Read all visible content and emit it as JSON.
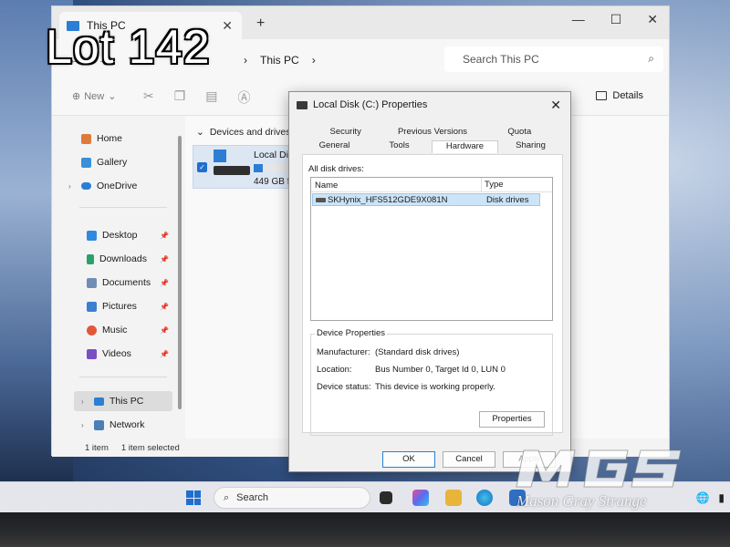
{
  "overlay": {
    "lot_label": "Lot 142",
    "watermark_logo": "MGS",
    "watermark_text": "Mason Gray Strange"
  },
  "explorer": {
    "tab_title": "This PC",
    "breadcrumb": [
      "This PC"
    ],
    "search_placeholder": "Search This PC",
    "toolbar": {
      "new_label": "New",
      "details_label": "Details"
    },
    "sidebar": {
      "items": [
        {
          "label": "Home",
          "icon": "home-icon"
        },
        {
          "label": "Gallery",
          "icon": "gallery-icon"
        },
        {
          "label": "OneDrive",
          "icon": "cloud-icon"
        },
        {
          "label": "Desktop",
          "icon": "desktop-icon"
        },
        {
          "label": "Downloads",
          "icon": "download-icon"
        },
        {
          "label": "Documents",
          "icon": "documents-icon"
        },
        {
          "label": "Pictures",
          "icon": "pictures-icon"
        },
        {
          "label": "Music",
          "icon": "music-icon"
        },
        {
          "label": "Videos",
          "icon": "videos-icon"
        },
        {
          "label": "This PC",
          "icon": "pc-icon"
        },
        {
          "label": "Network",
          "icon": "network-icon"
        }
      ]
    },
    "group_header": "Devices and drives",
    "drive": {
      "name": "Local Disk",
      "free_text": "449 GB fr",
      "usage_fraction": 0.22
    },
    "status": {
      "item_count": "1 item",
      "selected": "1 item selected"
    }
  },
  "dialog": {
    "title": "Local Disk (C:) Properties",
    "tabs_row1": [
      "Security",
      "Previous Versions",
      "Quota"
    ],
    "tabs_row2": [
      "General",
      "Tools",
      "Hardware",
      "Sharing"
    ],
    "active_tab": "Hardware",
    "all_disk_drives_label": "All disk drives:",
    "columns": [
      "Name",
      "Type"
    ],
    "rows": [
      {
        "name": "SKHynix_HFS512GDE9X081N",
        "type": "Disk drives"
      }
    ],
    "device_properties": {
      "legend": "Device Properties",
      "manufacturer_label": "Manufacturer:",
      "manufacturer": "(Standard disk drives)",
      "location_label": "Location:",
      "location": "Bus Number 0, Target Id 0, LUN 0",
      "status_label": "Device status:",
      "status": "This device is working properly.",
      "properties_button": "Properties"
    },
    "buttons": {
      "ok": "OK",
      "cancel": "Cancel",
      "apply": "Apply"
    }
  },
  "taskbar": {
    "search_label": "Search"
  }
}
